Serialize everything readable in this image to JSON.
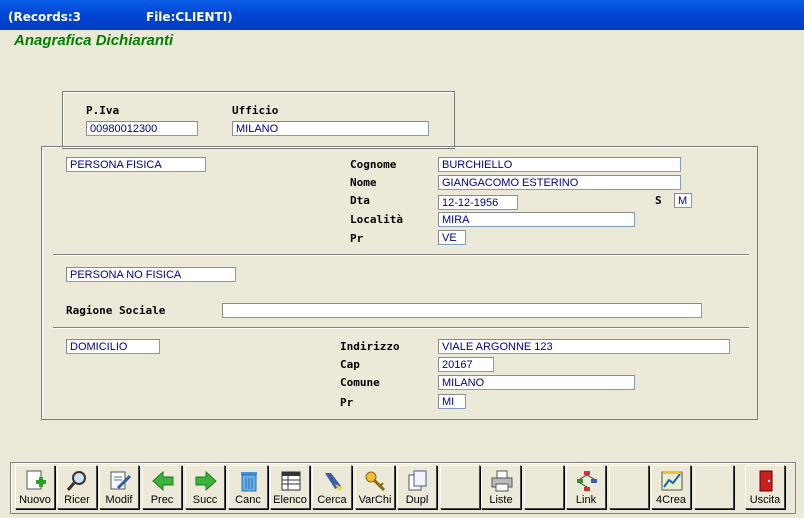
{
  "window": {
    "records": "(Records:3",
    "file": "File:CLIENTI)"
  },
  "heading": "Anagrafica Dichiaranti",
  "top": {
    "piva_label": "P.Iva",
    "piva": "00980012300",
    "ufficio_label": "Ufficio",
    "ufficio": "MILANO"
  },
  "persona_fisica": {
    "type": "PERSONA FISICA",
    "cognome_label": "Cognome",
    "cognome": "BURCHIELLO",
    "nome_label": "Nome",
    "nome": "GIANGACOMO ESTERINO",
    "dta_label": "Dta",
    "dta": "12-12-1956",
    "s_label": "S",
    "s": "M",
    "localita_label": "Località",
    "localita": "MIRA",
    "pr_label": "Pr",
    "pr": "VE"
  },
  "persona_no_fisica": {
    "type": "PERSONA NO FISICA",
    "ragione_label": "Ragione Sociale",
    "ragione": ""
  },
  "domicilio": {
    "type": "DOMICILIO",
    "indirizzo_label": "Indirizzo",
    "indirizzo": "VIALE ARGONNE 123",
    "cap_label": "Cap",
    "cap": "20167",
    "comune_label": "Comune",
    "comune": "MILANO",
    "pr_label": "Pr",
    "pr": "MI"
  },
  "toolbar": {
    "nuovo": "Nuovo",
    "ricer": "Ricer",
    "modif": "Modif",
    "prec": "Prec",
    "succ": "Succ",
    "canc": "Canc",
    "elenco": "Elenco",
    "cerca": "Cerca",
    "varchi": "VarChi",
    "dupl": "Dupl",
    "liste": "Liste",
    "link": "Link",
    "crea": "4Crea",
    "uscita": "Uscita"
  },
  "colors": {
    "title_bar": "#0046D5",
    "heading": "#008000",
    "field_text": "#00008B"
  }
}
